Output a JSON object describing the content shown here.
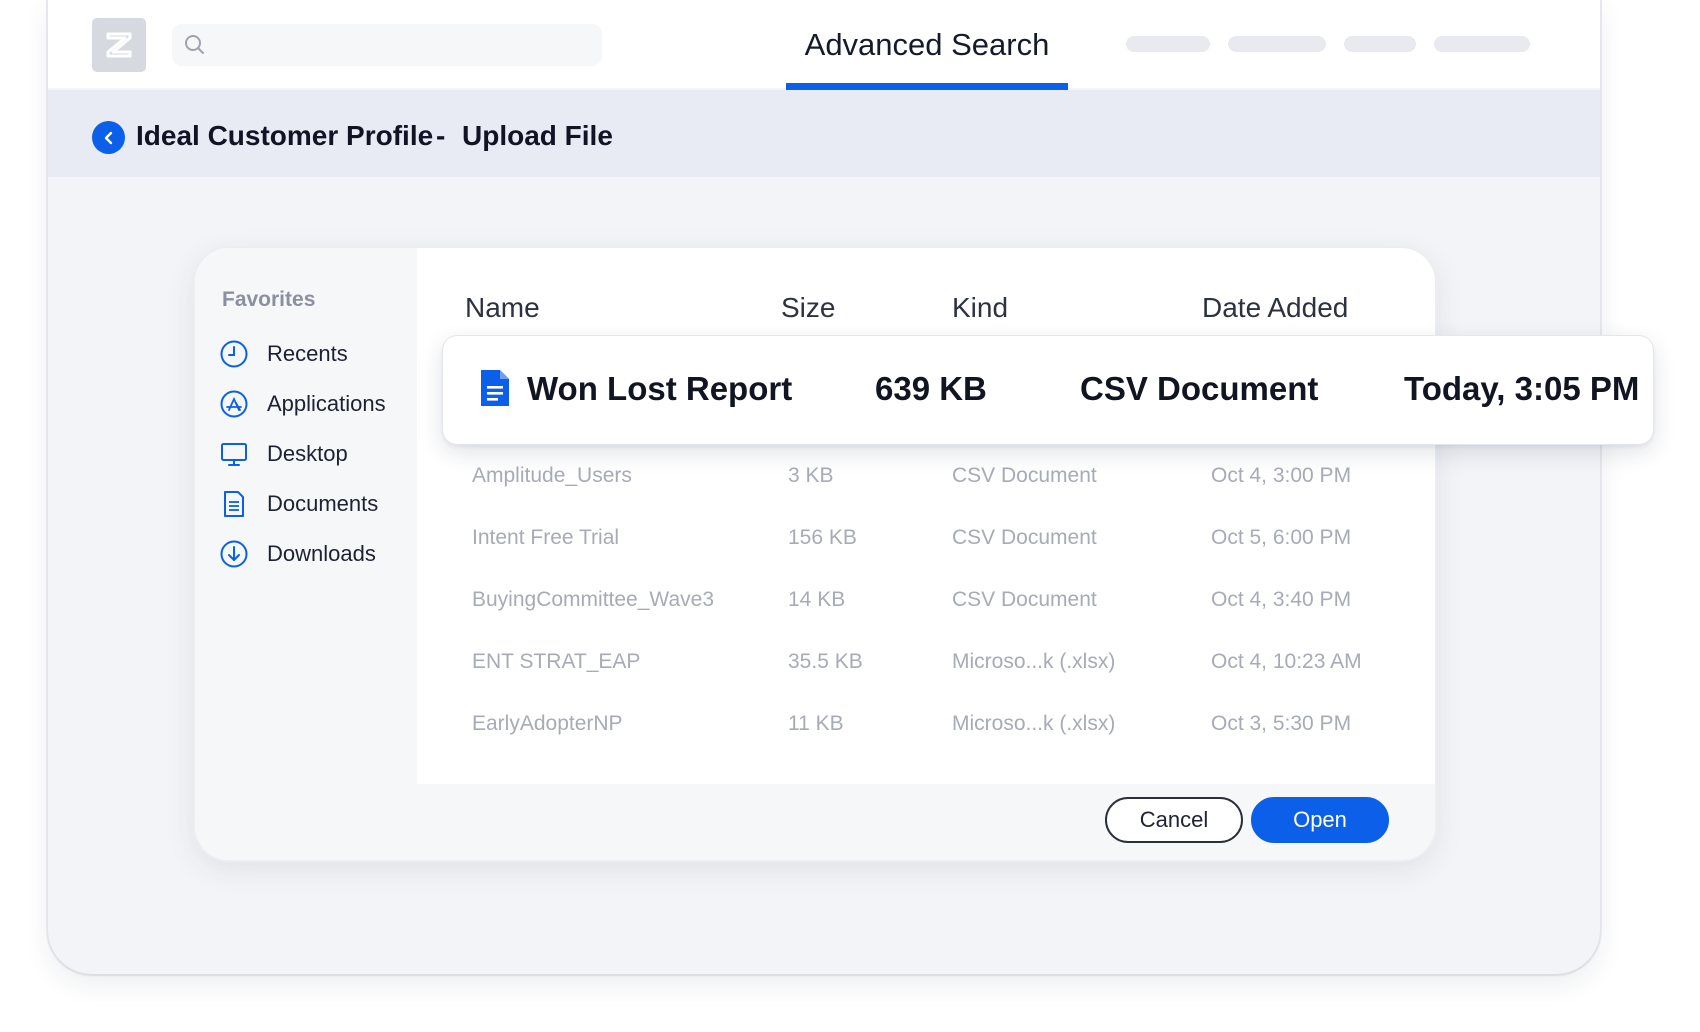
{
  "header": {
    "active_tab": "Advanced Search",
    "search": {
      "value": "",
      "placeholder": ""
    }
  },
  "breadcrumb": {
    "parent": "Ideal Customer Profile",
    "separator": "-",
    "current": "Upload File"
  },
  "file_dialog": {
    "sidebar": {
      "title": "Favorites",
      "items": [
        {
          "label": "Recents",
          "icon": "clock-icon"
        },
        {
          "label": "Applications",
          "icon": "app-store-icon"
        },
        {
          "label": "Desktop",
          "icon": "monitor-icon"
        },
        {
          "label": "Documents",
          "icon": "document-icon"
        },
        {
          "label": "Downloads",
          "icon": "download-icon"
        }
      ]
    },
    "columns": [
      "Name",
      "Size",
      "Kind",
      "Date Added"
    ],
    "selected_file": {
      "name": "Won Lost Report",
      "size": "639 KB",
      "kind": "CSV Document",
      "date": "Today, 3:05 PM",
      "icon": "doc-file-icon"
    },
    "files": [
      {
        "name": "Amplitude_Users",
        "size": "3 KB",
        "kind": "CSV Document",
        "date": "Oct 4, 3:00 PM"
      },
      {
        "name": "Intent Free Trial",
        "size": "156 KB",
        "kind": "CSV Document",
        "date": "Oct 5, 6:00 PM"
      },
      {
        "name": "BuyingCommittee_Wave3",
        "size": "14 KB",
        "kind": "CSV Document",
        "date": "Oct 4, 3:40 PM"
      },
      {
        "name": "ENT STRAT_EAP",
        "size": "35.5 KB",
        "kind": "Microso...k (.xlsx)",
        "date": "Oct 4, 10:23 AM"
      },
      {
        "name": "EarlyAdopterNP",
        "size": "11 KB",
        "kind": "Microso...k (.xlsx)",
        "date": "Oct 3, 5:30 PM"
      }
    ],
    "buttons": {
      "cancel": "Cancel",
      "open": "Open"
    }
  },
  "colors": {
    "accent": "#0b5fe8",
    "breadcrumb_bg": "#e8ebf3",
    "muted_text": "#a7abb6"
  }
}
